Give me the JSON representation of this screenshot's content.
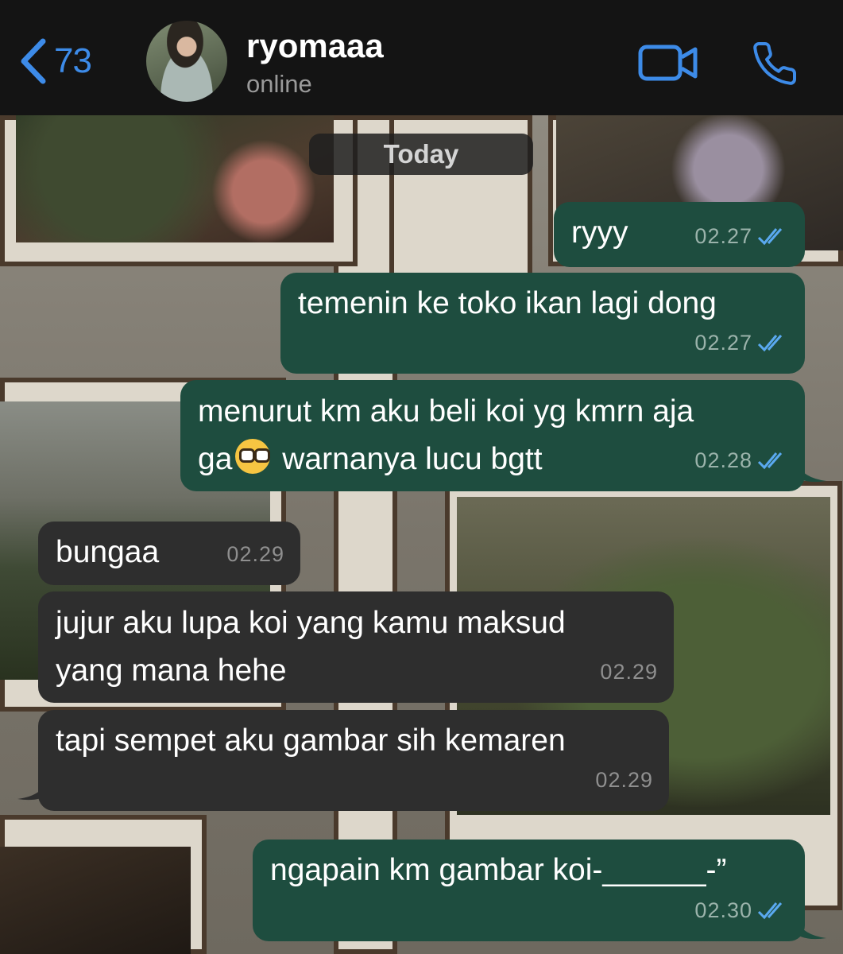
{
  "header": {
    "back_count": "73",
    "contact_name": "ryomaaa",
    "contact_status": "online",
    "accent_color": "#3d8be8",
    "icons": [
      "chevron-left-icon",
      "video-camera-icon",
      "phone-icon"
    ]
  },
  "chat": {
    "date_label": "Today",
    "messages": [
      {
        "direction": "outgoing",
        "text": "ryyy",
        "time": "02.27",
        "status": "read"
      },
      {
        "direction": "outgoing",
        "text": "temenin ke toko ikan lagi dong",
        "time": "02.27",
        "status": "read"
      },
      {
        "direction": "outgoing",
        "line1": "menurut km aku beli koi yg kmrn aja",
        "line2_before": "ga",
        "emoji": "nerd-face-emoji",
        "line2_after": " warnanya lucu bgtt",
        "time": "02.28",
        "status": "read"
      },
      {
        "direction": "incoming",
        "text": "bungaa",
        "time": "02.29"
      },
      {
        "direction": "incoming",
        "line1": "jujur aku lupa koi yang kamu maksud",
        "line2": "yang mana hehe",
        "time": "02.29"
      },
      {
        "direction": "incoming",
        "text": "tapi sempet aku gambar sih kemaren",
        "time": "02.29"
      },
      {
        "direction": "outgoing",
        "text": "ngapain km gambar koi-______-”",
        "time": "02.30",
        "status": "read"
      }
    ],
    "colors": {
      "outgoing_bubble": "#1e4d3f",
      "incoming_bubble": "#2e2e2e",
      "read_ticks": "#5aa9f0"
    }
  }
}
